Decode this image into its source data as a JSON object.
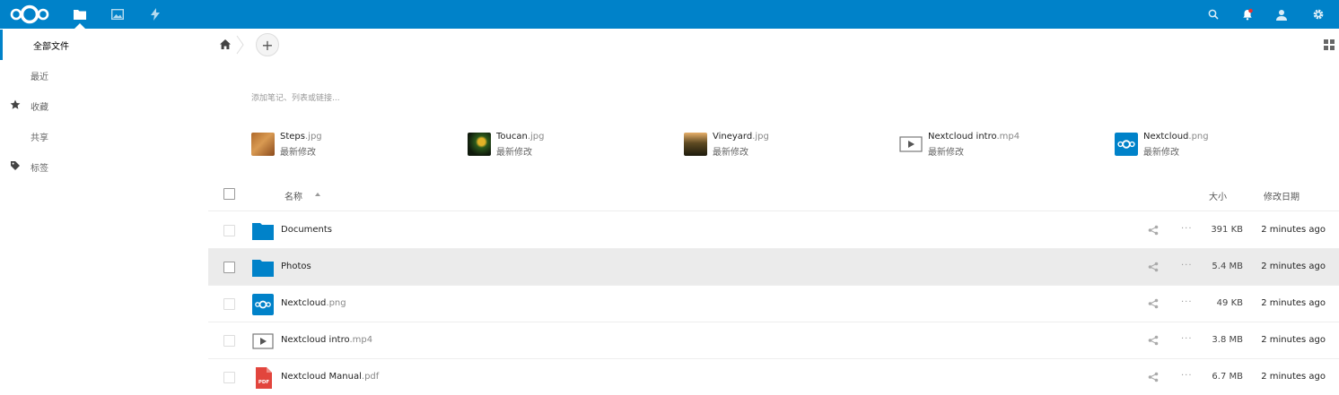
{
  "header": {
    "bg": "#0082c9",
    "icons": [
      "nextcloud-logo",
      "files-icon",
      "photos-icon",
      "activity-icon",
      "search-icon",
      "notifications-icon",
      "contacts-icon",
      "settings-icon"
    ]
  },
  "sidebar": {
    "items": [
      {
        "label": "全部文件",
        "icon": "",
        "active": true
      },
      {
        "label": "最近",
        "icon": ""
      },
      {
        "label": "收藏",
        "icon": "star-icon"
      },
      {
        "label": "共享",
        "icon": ""
      },
      {
        "label": "标签",
        "icon": "tag-icon"
      }
    ]
  },
  "controls": {
    "new_label": "+"
  },
  "notes": {
    "placeholder": "添加笔记、列表或链接..."
  },
  "recent": [
    {
      "base": "Steps",
      "ext": ".jpg",
      "sub": "最新修改",
      "thumb": "steps-thumbnail"
    },
    {
      "base": "Toucan",
      "ext": ".jpg",
      "sub": "最新修改",
      "thumb": "toucan-thumbnail"
    },
    {
      "base": "Vineyard",
      "ext": ".jpg",
      "sub": "最新修改",
      "thumb": "vineyard-thumbnail"
    },
    {
      "base": "Nextcloud intro",
      "ext": ".mp4",
      "sub": "最新修改",
      "thumb": "video-icon"
    },
    {
      "base": "Nextcloud",
      "ext": ".png",
      "sub": "最新修改",
      "thumb": "nextcloud-logo"
    }
  ],
  "table": {
    "col_name": "名称",
    "col_size": "大小",
    "col_modified": "修改日期",
    "more_label": "···",
    "rows": [
      {
        "base": "Documents",
        "ext": "",
        "size": "391 KB",
        "modified": "2 minutes ago",
        "icon": "folder-icon"
      },
      {
        "base": "Photos",
        "ext": "",
        "size": "5.4 MB",
        "modified": "2 minutes ago",
        "icon": "folder-icon"
      },
      {
        "base": "Nextcloud",
        "ext": ".png",
        "size": "49 KB",
        "modified": "2 minutes ago",
        "icon": "nextcloud-logo"
      },
      {
        "base": "Nextcloud intro",
        "ext": ".mp4",
        "size": "3.8 MB",
        "modified": "2 minutes ago",
        "icon": "video-icon"
      },
      {
        "base": "Nextcloud Manual",
        "ext": ".pdf",
        "size": "6.7 MB",
        "modified": "2 minutes ago",
        "icon": "pdf-icon"
      }
    ]
  },
  "colors": {
    "accent": "#0082c9",
    "folder": "#0082c9",
    "pdf": "#e2453d"
  }
}
